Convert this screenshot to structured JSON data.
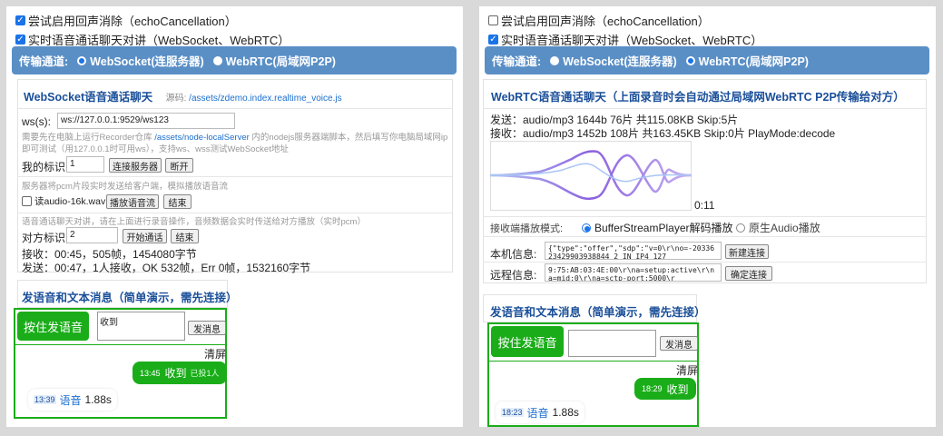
{
  "left": {
    "checkbox_echo": "尝试启用回声消除（echoCancellation）",
    "checkbox_realtime": "实时语音通话聊天对讲（WebSocket、WebRTC）",
    "transport_label": "传输通道:",
    "transport_ws": "WebSocket(连服务器)",
    "transport_rtc": "WebRTC(局域网P2P)",
    "ws_title": "WebSocket语音通话聊天",
    "source_label": "源码:",
    "source_link": "/assets/zdemo.index.realtime_voice.js",
    "ws_label": "ws(s):",
    "ws_url": "ws://127.0.0.1:9529/ws123",
    "server_note_pre": "需要先在电脑上运行Recorder仓库 ",
    "server_note_link": "/assets/node-localServer",
    "server_note_post": " 内的nodejs服务器端脚本，然后填写你电脑局域网ip即可测试（用127.0.0.1时可用ws），支持ws、wss测试WebSocket地址",
    "my_id_label": "我的标识",
    "my_id_value": "1",
    "connect_btn": "连接服务器",
    "disconnect_btn": "断开",
    "pcm_note": "服务器将pcm片段实时发送给客户端，模拟播放语音流",
    "read_audio_label": "读audio-16k.wav",
    "play_stream_btn": "播放语音流",
    "end_btn": "结束",
    "call_note": "语音通话聊天对讲，请在上面进行录音操作，音频数据会实时传送给对方播放（实时pcm）",
    "peer_id_label": "对方标识",
    "peer_id_value": "2",
    "start_call_btn": "开始通话",
    "end_call_btn": "结束",
    "recv_stat": "接收：00:45，505帧，1454080字节",
    "send_stat": "发送：00:47，1人接收，OK 532帧，Err 0帧，1532160字节",
    "msg_title": "发语音和文本消息（简单演示，需先连接）",
    "push_btn": "按住发语音",
    "msg_input": "收到",
    "send_msg_btn": "发消息",
    "clear_btn": "清屏",
    "msg1_time": "13:45",
    "msg1_text": "收到",
    "msg1_extra": "已投1人",
    "msg2_time": "13:39",
    "msg2_voice": "语音",
    "msg2_dur": "1.88s"
  },
  "right": {
    "checkbox_echo": "尝试启用回声消除（echoCancellation）",
    "checkbox_realtime": "实时语音通话聊天对讲（WebSocket、WebRTC）",
    "transport_label": "传输通道:",
    "transport_ws": "WebSocket(连服务器)",
    "transport_rtc": "WebRTC(局域网P2P)",
    "rtc_title": "WebRTC语音通话聊天（上面录音时会自动通过局域网WebRTC P2P传输给对方）",
    "send_stat": "发送：audio/mp3 1644b 76片 共115.08KB Skip:5片",
    "recv_stat": "接收：audio/mp3 1452b 108片 共163.45KB Skip:0片 PlayMode:decode",
    "wave_time": "0:11",
    "play_mode_label": "接收端播放模式:",
    "play_mode_1": "BufferStreamPlayer解码播放",
    "play_mode_2": "原生Audio播放",
    "local_info_label": "本机信息:",
    "local_info_value": "{\"type\":\"offer\",\"sdp\":\"v=0\\r\\no=-2033623429903938844 2 IN IP4 127",
    "new_conn_btn": "新建连接",
    "remote_info_label": "远程信息:",
    "remote_info_value": "9:75:AB:03:4E:00\\r\\na=setup:active\\r\\na=mid:0\\r\\na=sctp-port:5000\\r",
    "confirm_conn_btn": "确定连接",
    "msg_title": "发语音和文本消息（简单演示，需先连接）",
    "push_btn": "按住发语音",
    "msg_input": "",
    "send_msg_btn": "发消息",
    "clear_btn": "清屏",
    "msg1_time": "18:29",
    "msg1_text": "收到",
    "msg2_time": "18:23",
    "msg2_voice": "语音",
    "msg2_dur": "1.88s"
  },
  "colors": {
    "accent": "#1a73e8",
    "bar": "#5a8fc6",
    "green": "#1aad19",
    "title": "#1a4f99"
  }
}
